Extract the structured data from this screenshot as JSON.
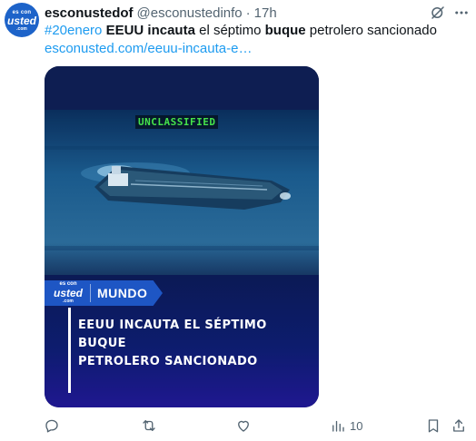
{
  "avatar": {
    "line1": "es con",
    "line2": "usted",
    "line3": ".com"
  },
  "author": {
    "display_name": "esconustedof",
    "handle": "@esconustedinfo",
    "separator": "·",
    "time": "17h"
  },
  "tweet": {
    "hashtag": "#20enero",
    "seg1": "EEUU incauta",
    "seg2": " el séptimo ",
    "seg3": "buque",
    "seg4": " petrolero sancionado",
    "link": "esconusted.com/eeuu-incauta-e…"
  },
  "media": {
    "overlay_text": "UNCLASSIFIED",
    "tag_logo": {
      "line1": "es con",
      "line2": "usted",
      "line3": ".com"
    },
    "tag_label": "MUNDO",
    "headline_line1": "EEUU INCAUTA EL SÉPTIMO BUQUE",
    "headline_line2": "PETROLERO SANCIONADO"
  },
  "actions": {
    "views_count": "10",
    "icons": [
      "reply-icon",
      "retweet-icon",
      "like-icon",
      "views-icon",
      "bookmark-icon",
      "share-icon"
    ]
  },
  "colors": {
    "link": "#1d9bf0",
    "secondary_text": "#536471",
    "brand_blue": "#1e56c4"
  }
}
